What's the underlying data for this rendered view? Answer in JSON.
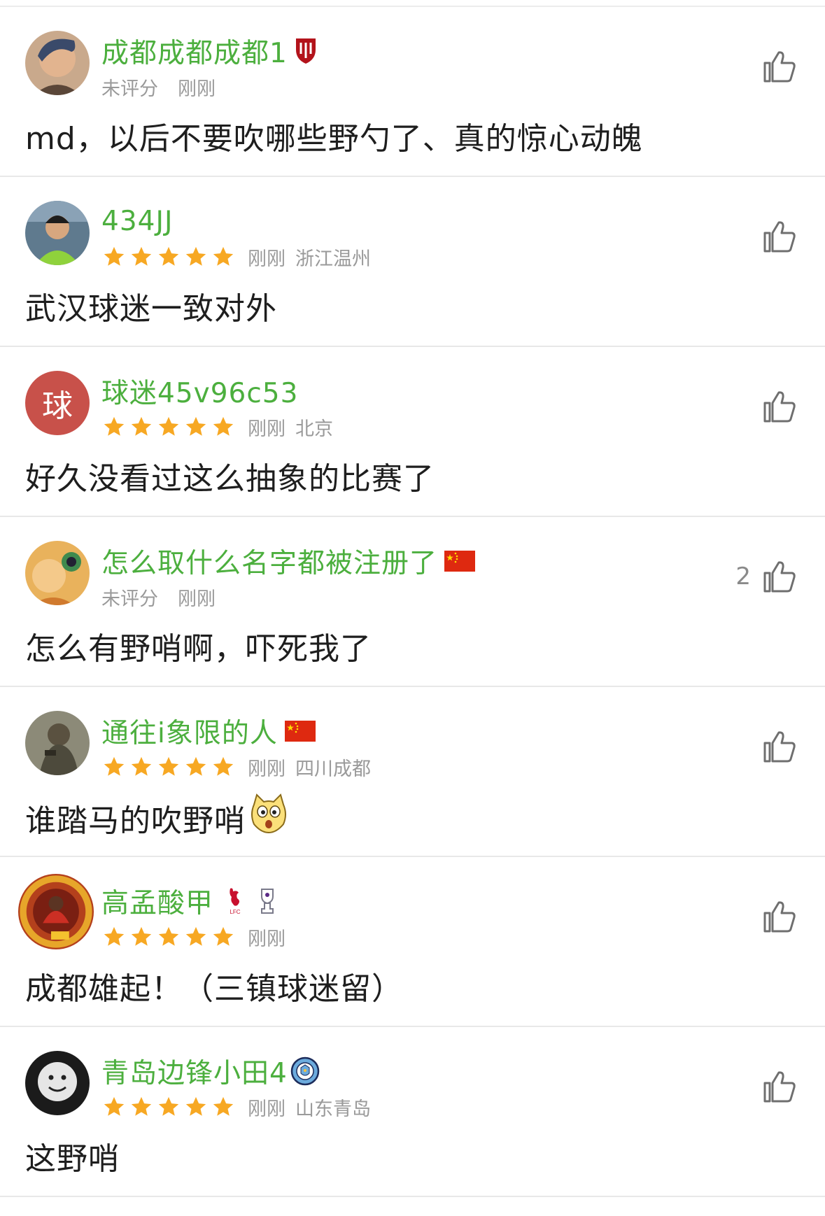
{
  "comments": [
    {
      "username": "成都成都成都1",
      "rating_text": "未评分",
      "time": "刚刚",
      "location": "",
      "content": "md，以后不要吹哪些野勺了、真的惊心动魄",
      "likes": "",
      "badge": "club-shield-icon",
      "stars": 0
    },
    {
      "username": "434JJ",
      "rating_text": "",
      "time": "刚刚",
      "location": "浙江温州",
      "content": "武汉球迷一致对外",
      "likes": "",
      "stars": 5
    },
    {
      "username": "球迷45v96c53",
      "avatar_text": "球",
      "rating_text": "",
      "time": "刚刚",
      "location": "北京",
      "content": "好久没看过这么抽象的比赛了",
      "likes": "",
      "stars": 5
    },
    {
      "username": "怎么取什么名字都被注册了",
      "rating_text": "未评分",
      "time": "刚刚",
      "location": "",
      "content": "怎么有野哨啊，吓死我了",
      "likes": "2",
      "badge": "china-flag-icon",
      "stars": 0
    },
    {
      "username": "通往i象限的人",
      "rating_text": "",
      "time": "刚刚",
      "location": "四川成都",
      "content": "谁踏马的吹野哨",
      "likes": "",
      "badge": "china-flag-icon",
      "emoji": "shocked-cat-emoji-icon",
      "stars": 5
    },
    {
      "username": "高孟酸甲",
      "rating_text": "",
      "time": "刚刚",
      "location": "",
      "content": "成都雄起！（三镇球迷留）",
      "likes": "",
      "badge": "liverpool-crest-icon",
      "stars": 5
    },
    {
      "username": "青岛边锋小田4",
      "rating_text": "",
      "time": "刚刚",
      "location": "山东青岛",
      "content": "这野哨",
      "likes": "",
      "badge": "man-city-crest-icon",
      "stars": 5
    }
  ],
  "colors": {
    "username": "#4caf3e",
    "star": "#f7a823",
    "meta": "#9a9a9a",
    "divider": "#e8e8e8"
  }
}
